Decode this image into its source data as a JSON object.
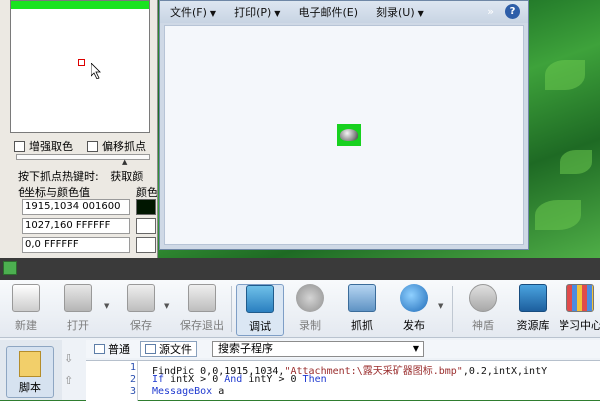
{
  "tool_panel": {
    "checkboxes": [
      "增强取色",
      "偏移抓点"
    ],
    "hotkey_label": "按下抓点热键时:",
    "hotkey_value": "获取颜色",
    "coord_legend": "坐标与颜色值",
    "coord_legend_right": "颜色",
    "rows": [
      {
        "text": "1915,1034  001600",
        "swatch": "#001600"
      },
      {
        "text": "1027,160  FFFFFF",
        "swatch": "#FFFFFF"
      },
      {
        "text": "0,0  FFFFFF",
        "swatch": "#FFFFFF"
      }
    ]
  },
  "explorer": {
    "menu": [
      "文件(F)",
      "打印(P)",
      "电子邮件(E)",
      "刻录(U)"
    ],
    "overflow": "»",
    "help": "?"
  },
  "toolbar": {
    "new": "新建",
    "open": "打开",
    "save": "保存",
    "save_exit": "保存退出",
    "debug": "调试",
    "record": "录制",
    "grab": "抓抓",
    "publish": "发布",
    "guard": "神盾",
    "resources": "资源库",
    "learn": "学习中心"
  },
  "side": {
    "script": "脚本"
  },
  "tabs": {
    "normal": "普通",
    "source": "源文件",
    "search_combo": "搜索子程序"
  },
  "code": {
    "lines": [
      {
        "n": "1",
        "parts": [
          [
            "FindPic 0,0,1915,1034,",
            ""
          ],
          [
            "\"Attachment:\\露天采矿器图标.bmp\"",
            "str"
          ],
          [
            ",0.2,intX,intY",
            ""
          ]
        ]
      },
      {
        "n": "2",
        "parts": [
          [
            "If",
            "kw"
          ],
          [
            " intX > 0 ",
            ""
          ],
          [
            "And",
            "kw"
          ],
          [
            " intY > 0 ",
            ""
          ],
          [
            "Then",
            "kw"
          ]
        ]
      },
      {
        "n": "3",
        "parts": [
          [
            "MessageBox",
            "kw"
          ],
          [
            " a",
            ""
          ]
        ]
      }
    ]
  },
  "colors": {
    "target_green": "#17D11F",
    "accent_blue": "#2E5EA8"
  }
}
